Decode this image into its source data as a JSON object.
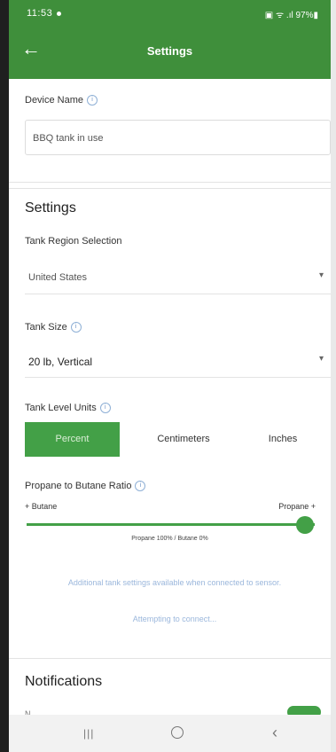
{
  "status_bar": {
    "time": "11:53",
    "icons": "▣ ᯤ .ıl 97%▮"
  },
  "header": {
    "title": "Settings"
  },
  "device_name": {
    "label": "Device Name",
    "value": "BBQ tank in use"
  },
  "settings": {
    "section_title": "Settings",
    "tank_region": {
      "label": "Tank Region Selection",
      "value": "United States"
    },
    "tank_size": {
      "label": "Tank Size",
      "value": "20 lb, Vertical"
    },
    "tank_level_units": {
      "label": "Tank Level Units",
      "options": [
        "Percent",
        "Centimeters",
        "Inches"
      ],
      "selected": "Percent"
    },
    "ratio": {
      "label": "Propane to Butane Ratio",
      "left_label": "+ Butane",
      "right_label": "Propane +",
      "readout": "Propane 100% / Butane 0%",
      "propane_percent": 100
    },
    "additional_info": "Additional tank settings available when connected to sensor.",
    "connect_status": "Attempting to connect..."
  },
  "notifications": {
    "section_title": "Notifications",
    "peek_label": "N..."
  },
  "colors": {
    "primary": "#3f8f3b",
    "accent": "#43a047",
    "link_blue": "#9bb7dc"
  },
  "icons": {
    "back": "arrow-left-icon",
    "info": "info-circle-icon",
    "caret": "chevron-down-icon"
  }
}
